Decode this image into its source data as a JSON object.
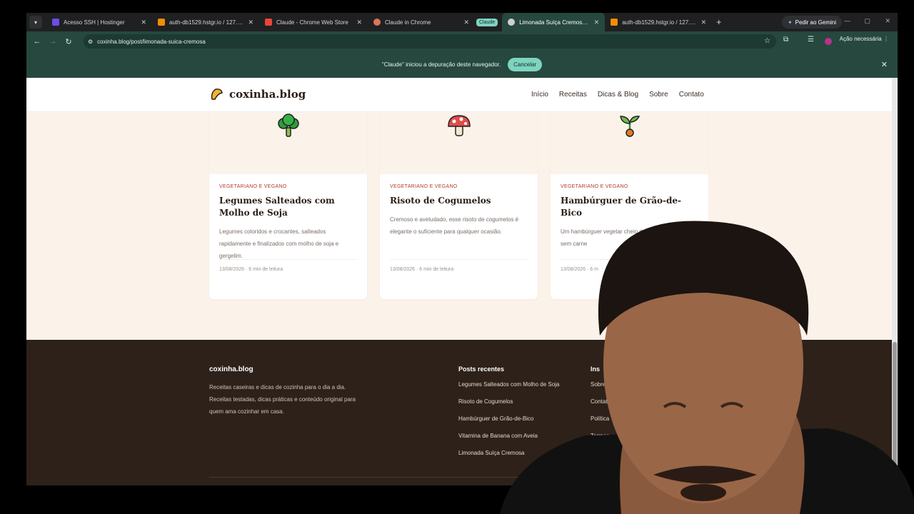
{
  "browser": {
    "tabs": [
      {
        "title": "Acesso SSH | Hostinger",
        "icon": "hostinger-icon",
        "color": "#6b4de6"
      },
      {
        "title": "auth-db1529.hstgr.io / 127.0.0",
        "icon": "phpmyadmin-icon",
        "color": "#f28c00"
      },
      {
        "title": "Claude - Chrome Web Store",
        "icon": "chrome-store-icon",
        "color": "#e8463a"
      },
      {
        "title": "Claude in Chrome",
        "icon": "claude-icon",
        "color": "#d97757"
      },
      {
        "title": "Limonada Suíça Cremosa | coxi",
        "icon": "globe-icon",
        "color": "#cfcfcf",
        "active": true
      },
      {
        "title": "auth-db1529.hstgr.io / 127.0.0",
        "icon": "phpmyadmin-icon",
        "color": "#f28c00"
      }
    ],
    "group_label": "Claude",
    "gemini_label": "Pedir ao Gemini",
    "url": "coxinha.blog/post/limonada-suica-cremosa",
    "action_needed": "Ação necessária",
    "debug_message": "\"Claude\" iniciou a depuração deste navegador.",
    "debug_cancel": "Cancelar"
  },
  "site": {
    "logo": "coxinha.blog",
    "nav": [
      "Início",
      "Receitas",
      "Dicas & Blog",
      "Sobre",
      "Contato"
    ],
    "cards": [
      {
        "icon": "broccoli-icon",
        "category": "Vegetariano e Vegano",
        "title": "Legumes Salteados com Molho de Soja",
        "desc": "Legumes coloridos e crocantes, salteados rapidamente e finalizados com molho de soja e gergelim.",
        "meta": "13/08/2026 · 6 min de leitura"
      },
      {
        "icon": "mushroom-icon",
        "category": "Vegetariano e Vegano",
        "title": "Risoto de Cogumelos",
        "desc": "Cremoso e aveludado, esse risoto de cogumelos é elegante o suficiente para qualquer ocasião.",
        "meta": "13/08/2026 · 6 min de leitura"
      },
      {
        "icon": "seedling-icon",
        "category": "Vegetariano e Vegano",
        "title": "Hambúrguer de Grão-de-Bico",
        "desc": "Um hambúrguer vegetar cheio de textura, per opções sem carne",
        "meta": "13/08/2026 · 6 m"
      }
    ],
    "footer": {
      "brand": "coxinha.blog",
      "desc": "Receitas caseiras e dicas de cozinha para o dia a dia. Receitas testadas, dicas práticas e conteúdo original para quem ama cozinhar em casa.",
      "recent_heading": "Posts recentes",
      "recent": [
        "Legumes Salteados com Molho de Soja",
        "Risoto de Cogumelos",
        "Hambúrguer de Grão-de-Bico",
        "Vitamina de Banana com Aveia",
        "Limonada Suíça Cremosa"
      ],
      "inst_heading": "Ins",
      "inst": [
        "Sobre",
        "Contato",
        "Política",
        "Termos"
      ]
    }
  }
}
